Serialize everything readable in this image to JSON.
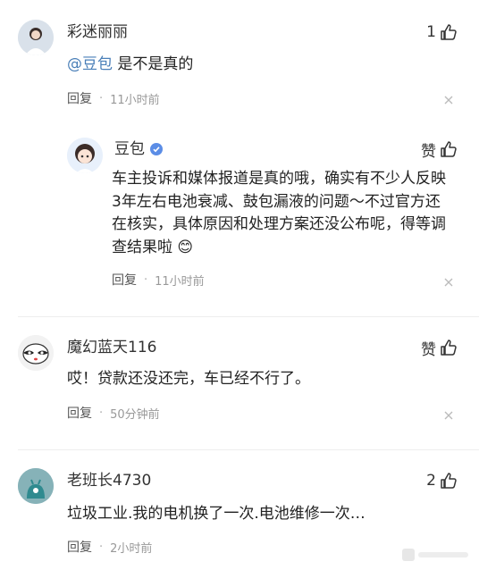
{
  "comments": [
    {
      "username": "彩迷丽丽",
      "like_count": "1",
      "mention": "@豆包",
      "text": " 是不是真的",
      "reply_label": "回复",
      "time": "11小时前"
    },
    {
      "username": "豆包",
      "like_label": "赞",
      "text_lines": [
        "车主投诉和媒体报道是真的哦，确实有不少人反映",
        "3年左右电池衰减、鼓包漏液的问题～不过官方还",
        "在核实，具体原因和处理方案还没公布呢，得等调",
        "查结果啦 😊"
      ],
      "reply_label": "回复",
      "time": "11小时前"
    },
    {
      "username": "魔幻蓝天116",
      "like_label": "赞",
      "text": "哎！贷款还没还完，车已经不行了。",
      "reply_label": "回复",
      "time": "50分钟前"
    },
    {
      "username": "老班长4730",
      "like_count": "2",
      "text": "垃圾工业.我的电机换了一次.电池维修一次…",
      "reply_label": "回复",
      "time": "2小时前"
    }
  ],
  "icons": {
    "like": "thumbs-up-icon",
    "close": "close-icon",
    "verified": "verified-badge-icon"
  },
  "colors": {
    "mention": "#4a7fb8",
    "verified": "#5b8de6",
    "meta": "#999999"
  }
}
